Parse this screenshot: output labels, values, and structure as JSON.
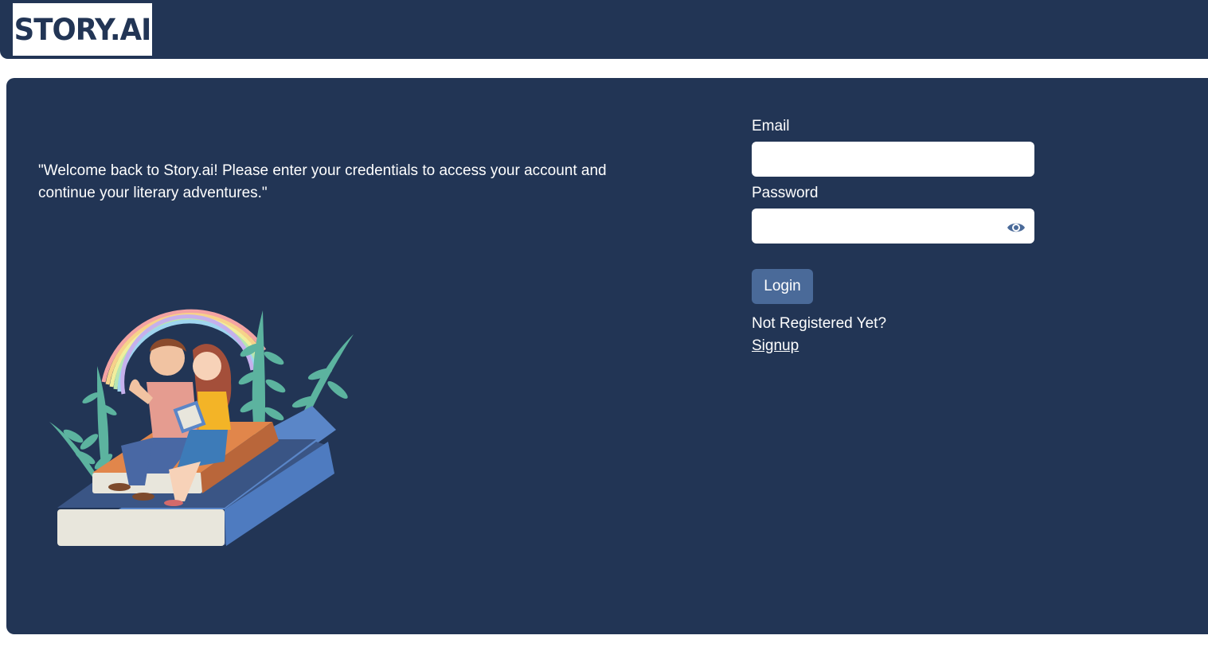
{
  "header": {
    "logo_text": "STORY.AI"
  },
  "main": {
    "welcome_text": "\"Welcome back to Story.ai! Please enter your credentials to access your account and continue your literary adventures.\""
  },
  "login_form": {
    "email_label": "Email",
    "email_value": "",
    "password_label": "Password",
    "password_value": "",
    "login_button": "Login",
    "not_registered_text": "Not Registered Yet?",
    "signup_link": "Signup"
  },
  "icons": {
    "password_toggle": "eye-icon"
  },
  "colors": {
    "background": "#223555",
    "button": "#4a6a99",
    "text": "#ffffff"
  }
}
